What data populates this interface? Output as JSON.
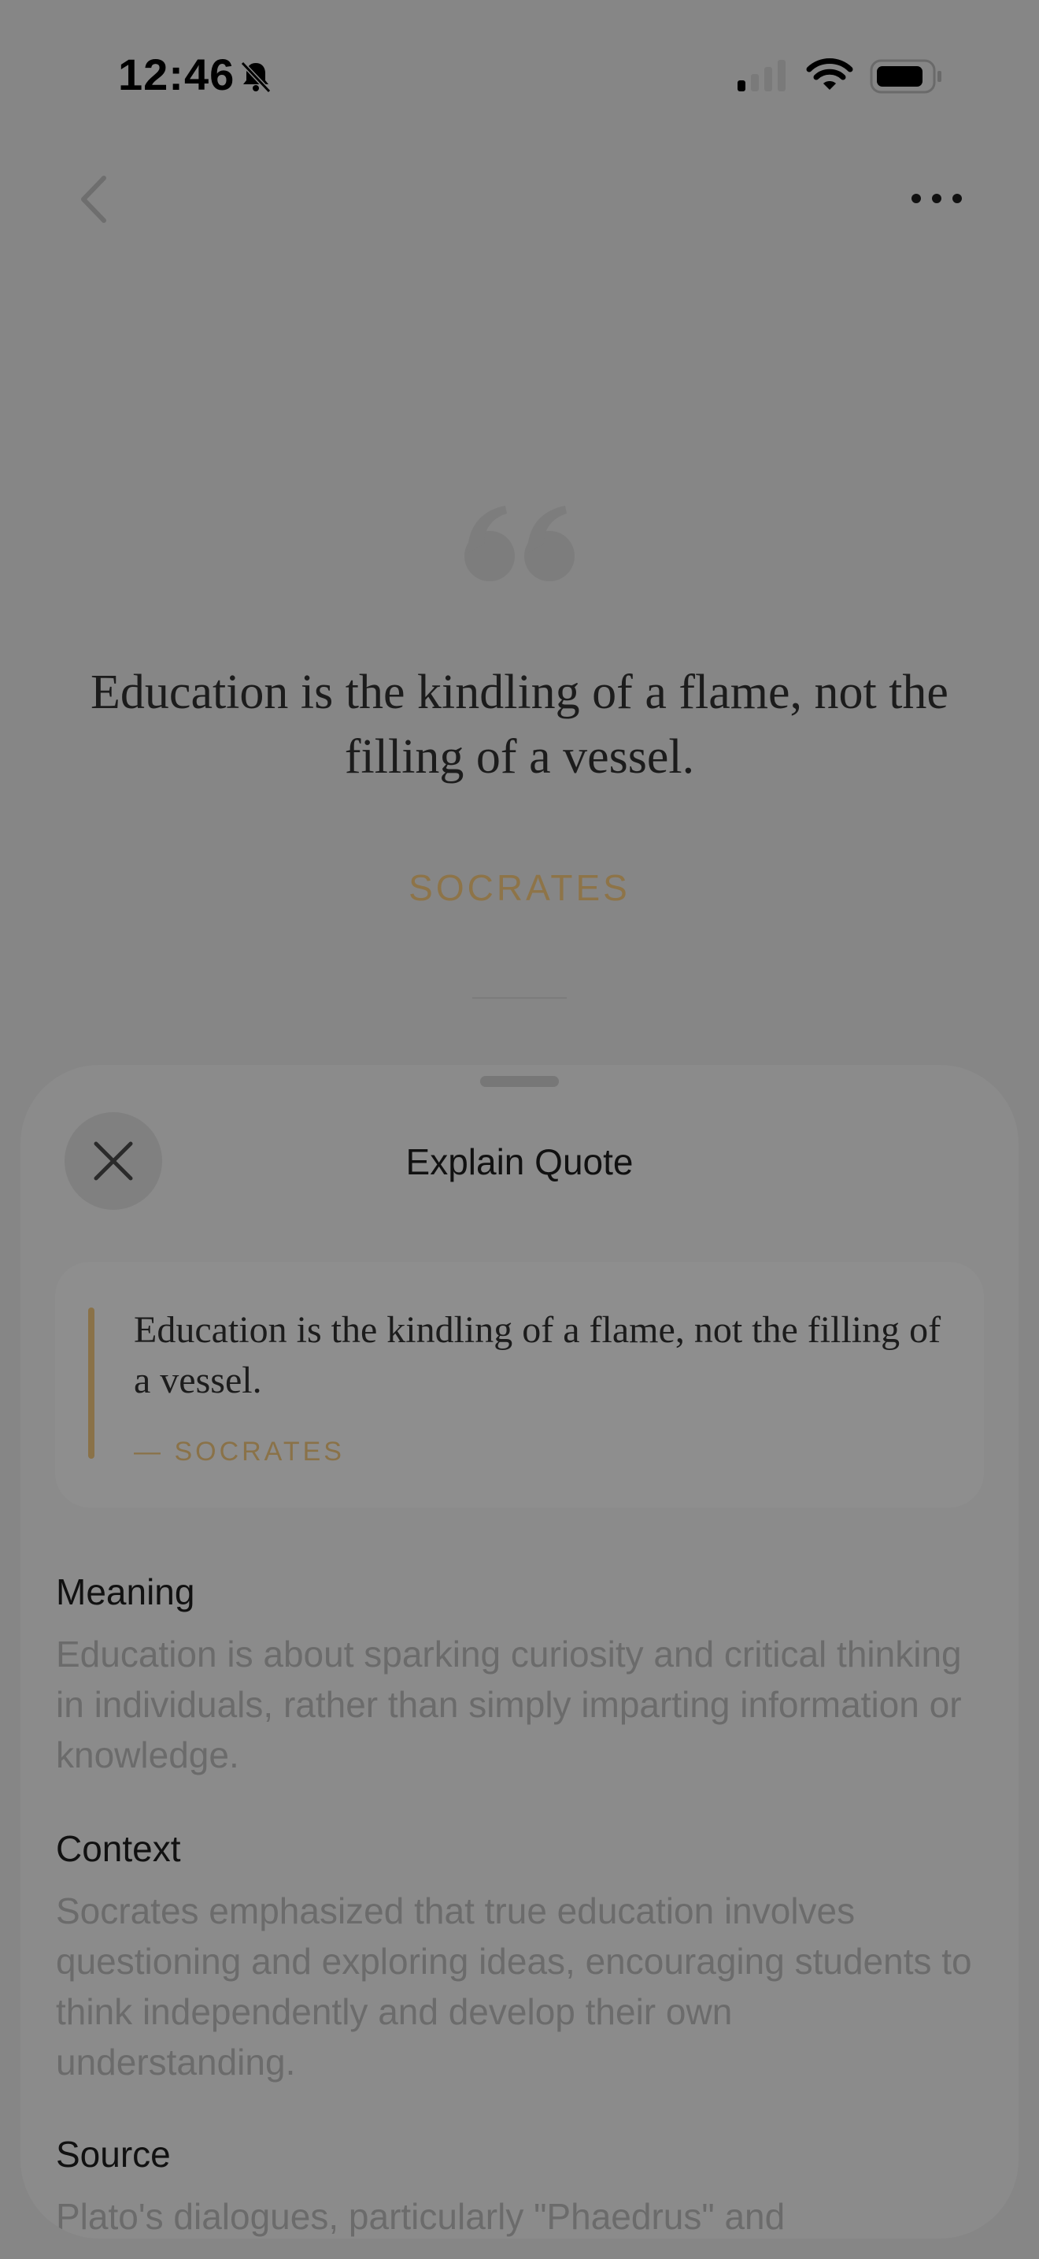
{
  "status_bar": {
    "time": "12:46",
    "icons": [
      "bell-slash-icon",
      "cellular-signal-icon",
      "wifi-icon",
      "battery-icon"
    ]
  },
  "nav": {
    "back_icon": "chevron-left-icon",
    "more_icon": "ellipsis-icon"
  },
  "quote": {
    "mark_icon": "quotation-mark-icon",
    "text": "Education is the kindling of a flame, not the filling of a vessel.",
    "author": "SOCRATES"
  },
  "sheet": {
    "close_icon": "close-icon",
    "title": "Explain Quote",
    "card": {
      "text": "Education is the kindling of a flame, not the filling of a vessel.",
      "author": "— SOCRATES"
    },
    "sections": [
      {
        "title": "Meaning",
        "body": "Education is about sparking curiosity and critical thinking in individuals, rather than simply imparting information or knowledge."
      },
      {
        "title": "Context",
        "body": "Socrates emphasized that true education involves questioning and exploring ideas, encouraging students to think independently and develop their own understanding."
      },
      {
        "title": "Source",
        "body": "Plato's dialogues, particularly \"Phaedrus\" and"
      }
    ]
  },
  "colors": {
    "accent_gold": "#8a7248",
    "overlay_gray": "#868686"
  }
}
